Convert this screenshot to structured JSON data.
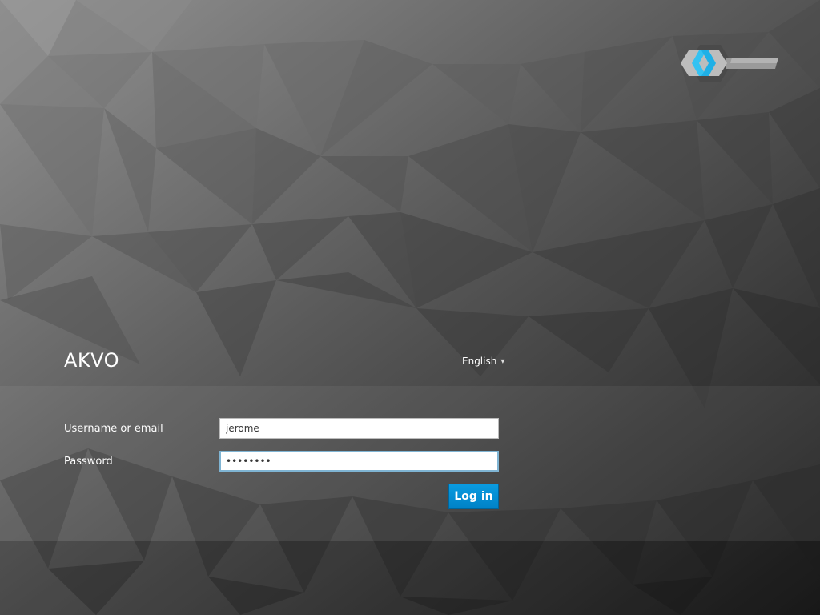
{
  "app": {
    "realm_title": "AKVO",
    "brand_logo_icon": "keycloak-logo-icon"
  },
  "locale": {
    "label": "English",
    "caret_icon": "caret-down-icon"
  },
  "form": {
    "username_label": "Username or email",
    "username_value": "jerome",
    "password_label": "Password",
    "password_value": "********",
    "submit_label": "Log in"
  },
  "colors": {
    "accent": "#0088ce",
    "logo_blue": "#33c2f2",
    "text": "#ffffff"
  }
}
